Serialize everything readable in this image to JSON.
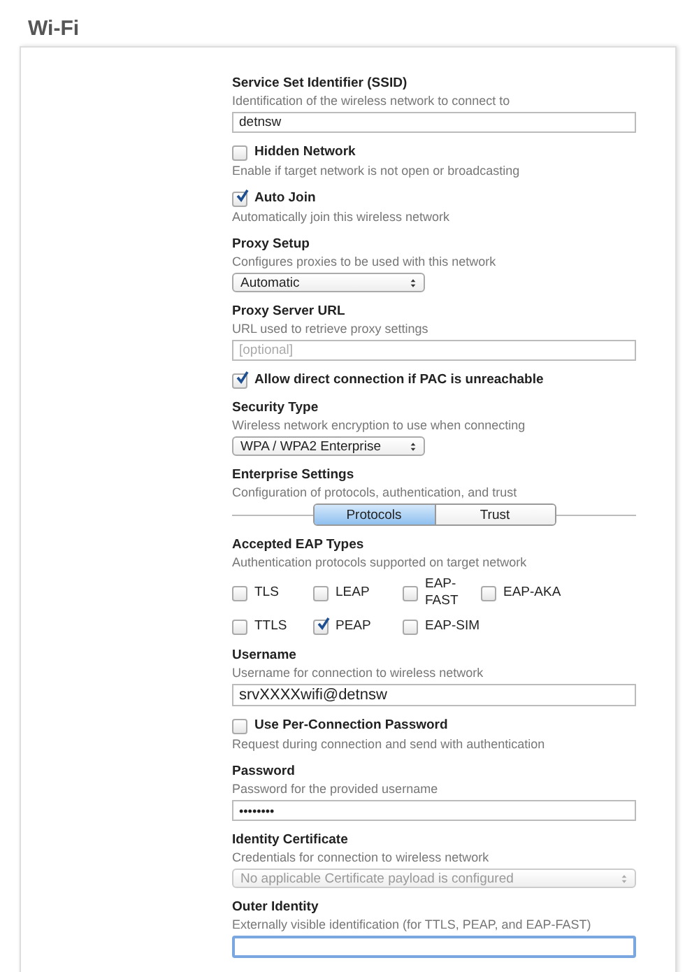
{
  "title": "Wi-Fi",
  "fields": [
    {
      "kind": "text",
      "label": "Service Set Identifier (SSID)",
      "description": "Identification of the wireless network to connect to",
      "value": "detnsw"
    },
    {
      "kind": "checkbox",
      "label": "Hidden Network",
      "description": "Enable if target network is not open or broadcasting",
      "checked": false
    },
    {
      "kind": "checkbox",
      "label": "Auto Join",
      "description": "Automatically join this wireless network",
      "checked": true
    },
    {
      "kind": "select",
      "label": "Proxy Setup",
      "description": "Configures proxies to be used with this network",
      "value": "Automatic",
      "disabled": false
    },
    {
      "kind": "text",
      "label": "Proxy Server URL",
      "description": "URL used to retrieve proxy settings",
      "placeholder": "[optional]"
    },
    {
      "kind": "checkbox",
      "label": "Allow direct connection if PAC is unreachable",
      "checked": true
    },
    {
      "kind": "select",
      "label": "Security Type",
      "description": "Wireless network encryption to use when connecting",
      "value": "WPA / WPA2 Enterprise",
      "disabled": false
    },
    {
      "kind": "segmented",
      "label": "Enterprise Settings",
      "description": "Configuration of protocols, authentication, and trust",
      "segments": [
        {
          "label": "Protocols",
          "selected": true
        },
        {
          "label": "Trust",
          "selected": false
        }
      ]
    },
    {
      "kind": "checkbox-grid",
      "label": "Accepted EAP Types",
      "description": "Authentication protocols supported on target network",
      "rows": [
        [
          {
            "label": "TLS",
            "checked": false
          },
          {
            "label": "LEAP",
            "checked": false
          },
          {
            "label": "EAP-FAST",
            "checked": false
          },
          {
            "label": "EAP-AKA",
            "checked": false
          }
        ],
        [
          {
            "label": "TTLS",
            "checked": false
          },
          {
            "label": "PEAP",
            "checked": true
          },
          {
            "label": "EAP-SIM",
            "checked": false
          }
        ]
      ]
    },
    {
      "kind": "text",
      "label": "Username",
      "description": "Username for connection to wireless network",
      "value": "srvXXXXwifi@detnsw"
    },
    {
      "kind": "checkbox",
      "label": "Use Per-Connection Password",
      "description": "Request during connection and send with authentication",
      "checked": false
    },
    {
      "kind": "password",
      "label": "Password",
      "description": "Password for the provided username",
      "value": "••••••••"
    },
    {
      "kind": "select",
      "label": "Identity Certificate",
      "description": "Credentials for connection to wireless network",
      "value": "No applicable Certificate payload is configured",
      "disabled": true
    },
    {
      "kind": "text",
      "label": "Outer Identity",
      "description": "Externally visible identification (for TTLS, PEAP, and EAP-FAST)",
      "focused": true
    }
  ]
}
